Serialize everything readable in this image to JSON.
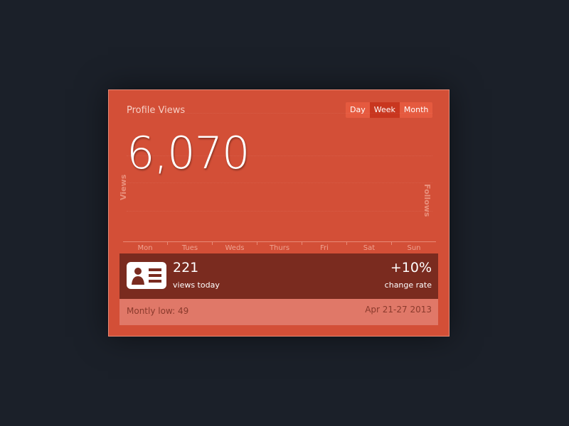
{
  "widget": {
    "title": "Profile Views",
    "tabs": [
      {
        "label": "Day",
        "active": false
      },
      {
        "label": "Week",
        "active": true
      },
      {
        "label": "Month",
        "active": false
      }
    ],
    "total": "6,070",
    "left_axis_label": "Views",
    "right_axis_label": "Follows",
    "days": [
      "Mon",
      "Tues",
      "Weds",
      "Thurs",
      "Fri",
      "Sat",
      "Sun"
    ]
  },
  "stats": {
    "icon": "profile-card-icon",
    "views_today": "221",
    "views_today_label": "views today",
    "change": "+10%",
    "change_label": "change rate"
  },
  "footer": {
    "low": "Montly low: 49",
    "range": "Apr 21-27 2013"
  },
  "colors": {
    "card": "#d34f37",
    "stats_bg": "#7a2b1f",
    "footer_bg": "#e07868",
    "active_tab": "#c8361f"
  }
}
